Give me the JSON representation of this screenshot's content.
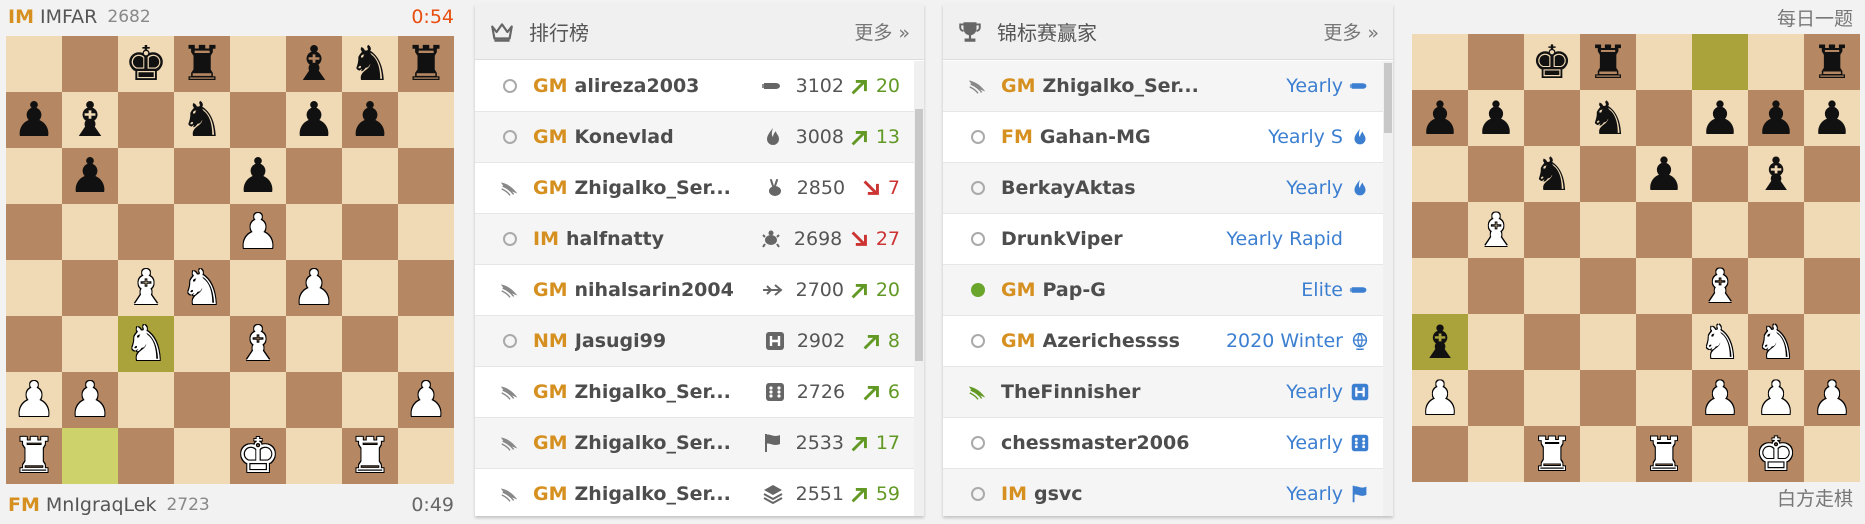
{
  "live_game": {
    "top_player": {
      "title": "IM",
      "name": "IMFAR",
      "rating": "2682",
      "clock": "0:54"
    },
    "bottom_player": {
      "title": "FM",
      "name": "MnIgraqLek",
      "rating": "2723",
      "clock": "0:49"
    },
    "board": [
      "  kr bnr",
      "pb n pp ",
      " p  p   ",
      "    P   ",
      "  BN P  ",
      "  N B   ",
      "PP     P",
      "R   K R "
    ],
    "highlights": [
      [
        7,
        1
      ],
      [
        5,
        2
      ]
    ]
  },
  "leaderboard": {
    "title": "排行榜",
    "more": "更多 »",
    "icon": "crown-icon",
    "rows": [
      {
        "status": "offline",
        "title": "GM",
        "name": "alireza2003",
        "perf_icon": "bullet-icon",
        "rating": "3102",
        "trend": "up",
        "progress": "20"
      },
      {
        "status": "offline",
        "title": "GM",
        "name": "Konevlad",
        "perf_icon": "blitz-icon",
        "rating": "3008",
        "trend": "up",
        "progress": "13"
      },
      {
        "status": "patron",
        "title": "GM",
        "name": "Zhigalko_Ser...",
        "perf_icon": "rabbit-icon",
        "rating": "2850",
        "trend": "down",
        "progress": "7"
      },
      {
        "status": "offline",
        "title": "IM",
        "name": "halfnatty",
        "perf_icon": "turtle-icon",
        "rating": "2698",
        "trend": "down",
        "progress": "27"
      },
      {
        "status": "patron",
        "title": "GM",
        "name": "nihalsarin2004",
        "perf_icon": "ultrabullet-icon",
        "rating": "2700",
        "trend": "up",
        "progress": "20"
      },
      {
        "status": "offline",
        "title": "NM",
        "name": "Jasugi99",
        "perf_icon": "horde-icon",
        "rating": "2902",
        "trend": "up",
        "progress": "8"
      },
      {
        "status": "patron",
        "title": "GM",
        "name": "Zhigalko_Ser...",
        "perf_icon": "chess960-icon",
        "rating": "2726",
        "trend": "up",
        "progress": "6"
      },
      {
        "status": "patron",
        "title": "GM",
        "name": "Zhigalko_Ser...",
        "perf_icon": "flag-icon",
        "rating": "2533",
        "trend": "up",
        "progress": "17"
      },
      {
        "status": "patron",
        "title": "GM",
        "name": "Zhigalko_Ser...",
        "perf_icon": "layers-icon",
        "rating": "2551",
        "trend": "up",
        "progress": "59"
      }
    ]
  },
  "winners": {
    "title": "锦标赛赢家",
    "more": "更多 »",
    "icon": "trophy-icon",
    "rows": [
      {
        "status": "patron",
        "title": "GM",
        "name": "Zhigalko_Ser...",
        "tournament": "Yearly",
        "perf_icon": "bullet-icon"
      },
      {
        "status": "offline",
        "title": "FM",
        "name": "Gahan-MG",
        "tournament": "Yearly S",
        "perf_icon": "blitz-icon"
      },
      {
        "status": "offline",
        "title": "",
        "name": "BerkayAktas",
        "tournament": "Yearly",
        "perf_icon": "blitz-icon"
      },
      {
        "status": "offline",
        "title": "",
        "name": "DrunkViper",
        "tournament": "Yearly Rapid",
        "perf_icon": ""
      },
      {
        "status": "online",
        "title": "GM",
        "name": "Pap-G",
        "tournament": "Elite",
        "perf_icon": "bullet-icon"
      },
      {
        "status": "offline",
        "title": "GM",
        "name": "Azerichessss",
        "tournament": "2020 Winter",
        "perf_icon": "globe-icon"
      },
      {
        "status": "patron-green",
        "title": "",
        "name": "TheFinnisher",
        "tournament": "Yearly",
        "perf_icon": "horde-icon"
      },
      {
        "status": "offline",
        "title": "",
        "name": "chessmaster2006",
        "tournament": "Yearly",
        "perf_icon": "chess960-icon"
      },
      {
        "status": "offline",
        "title": "IM",
        "name": "gsvc",
        "tournament": "Yearly",
        "perf_icon": "flag-icon"
      }
    ]
  },
  "puzzle": {
    "label_top": "每日一题",
    "label_bottom": "白方走棋",
    "board": [
      "  kr   r",
      "pp n ppp",
      "  n p b ",
      " B      ",
      "     B  ",
      "b    NN ",
      "P    PPP",
      "  R R K "
    ],
    "highlights": [
      [
        0,
        5
      ],
      [
        5,
        0
      ]
    ]
  },
  "colors": {
    "title": "#d59020",
    "up": "#629924",
    "down": "#cc3333",
    "link": "#3c7fd1",
    "low_clock": "#e84e0f"
  }
}
